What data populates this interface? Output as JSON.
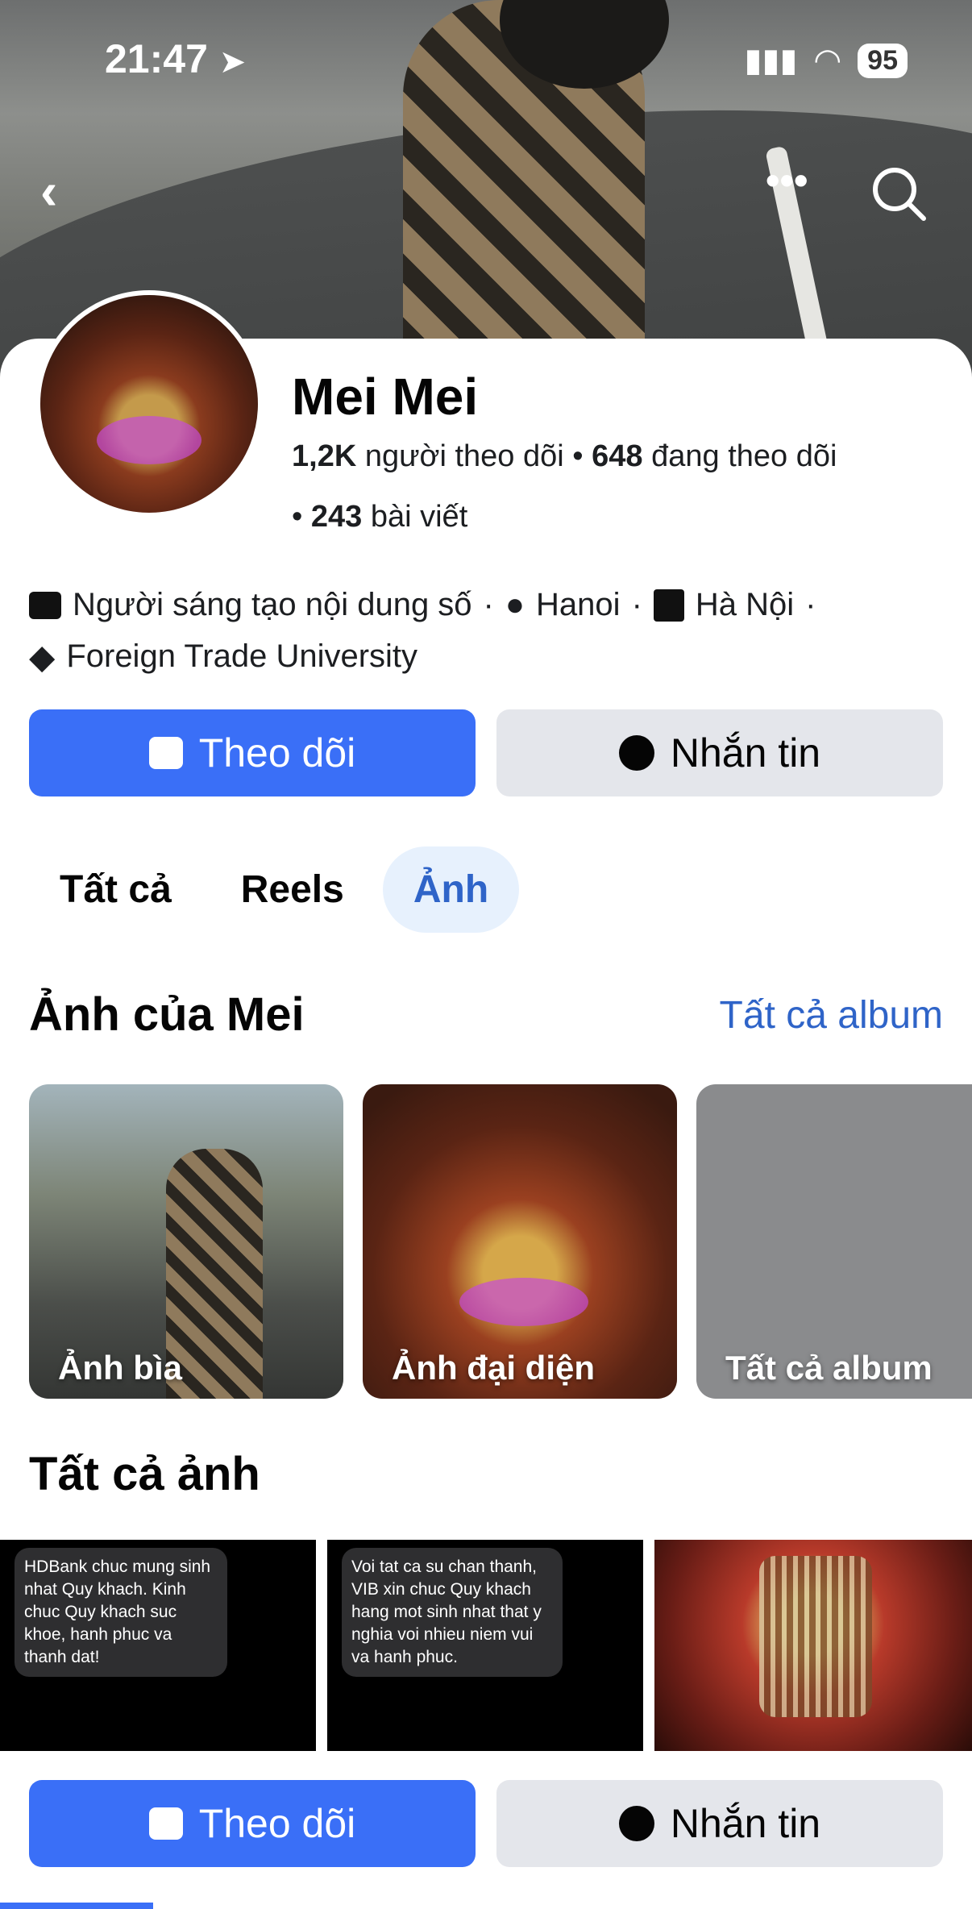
{
  "status_bar": {
    "time": "21:47",
    "battery": "95"
  },
  "profile": {
    "name": "Mei Mei",
    "followers_count": "1,2K",
    "followers_label": "người theo dõi",
    "following_count": "648",
    "following_label": "đang theo dõi",
    "posts_count": "243",
    "posts_label": "bài viết",
    "category": "Người sáng tạo nội dung số",
    "location": "Hanoi",
    "city": "Hà Nội",
    "school": "Foreign Trade University"
  },
  "buttons": {
    "follow": "Theo dõi",
    "message": "Nhắn tin"
  },
  "tabs": [
    "Tất cả",
    "Reels",
    "Ảnh"
  ],
  "photos_section": {
    "title": "Ảnh của Mei",
    "all_albums_link": "Tất cả album",
    "cards": [
      "Ảnh bìa",
      "Ảnh đại diện",
      "Tất cả album"
    ]
  },
  "all_photos": {
    "title": "Tất cả ảnh",
    "items": [
      "HDBank chuc mung sinh nhat Quy khach. Kinh chuc Quy khach suc khoe, hanh phuc va thanh dat!",
      "Voi tat ca su chan thanh, VIB xin chuc Quy khach hang mot sinh nhat that y nghia voi nhieu niem vui va hanh phuc."
    ]
  },
  "colors": {
    "primary": "#3a6ff7",
    "link": "#2f64c8",
    "secondary_button": "#e4e6eb"
  }
}
